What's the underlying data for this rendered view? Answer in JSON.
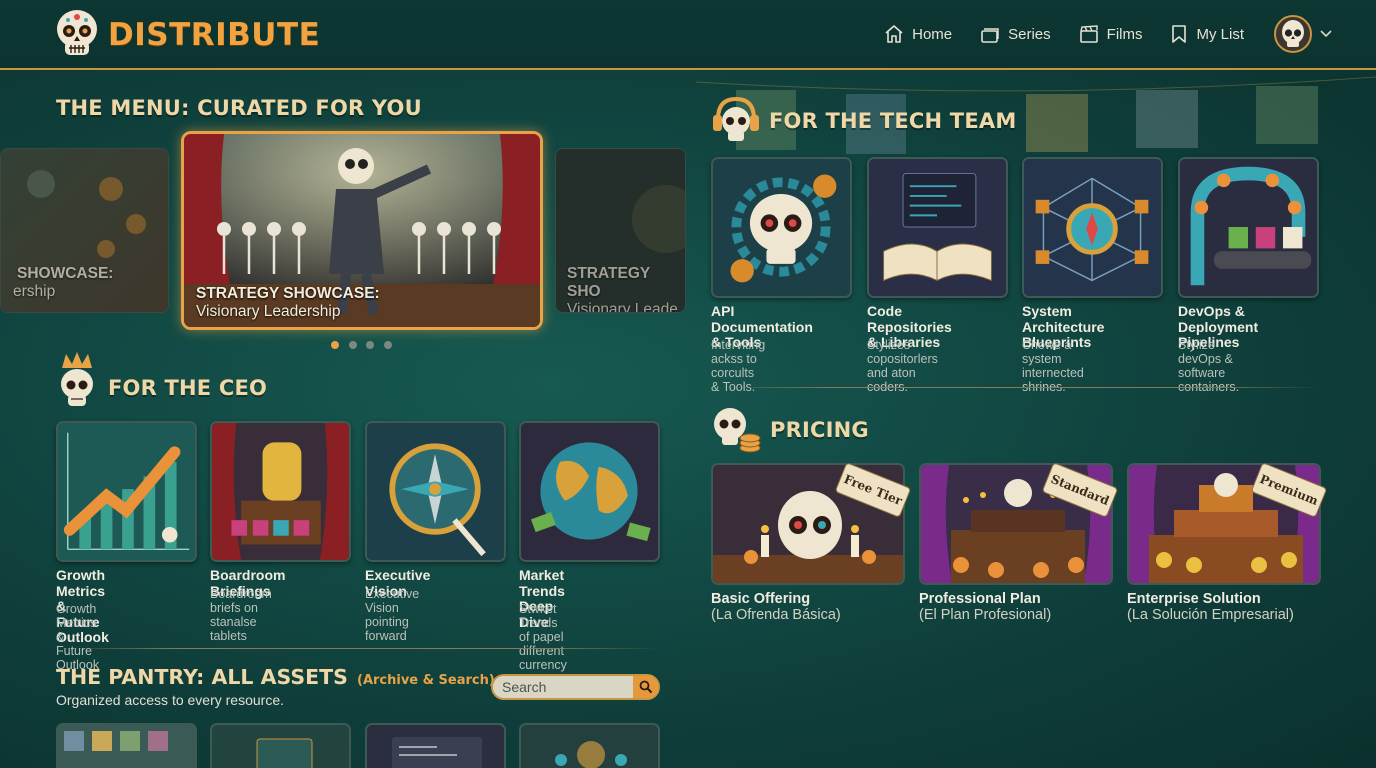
{
  "brand": {
    "name": "DISTRIBUTE",
    "logo_icon": "sugar-skull-icon"
  },
  "nav": {
    "items": [
      {
        "label": "Home",
        "icon": "house-icon"
      },
      {
        "label": "Series",
        "icon": "stack-icon"
      },
      {
        "label": "Films",
        "icon": "clapperboard-icon"
      },
      {
        "label": "My List",
        "icon": "bookmark-icon"
      }
    ],
    "avatar_icon": "skull-avatar-icon",
    "caret_icon": "chevron-down-icon"
  },
  "menu": {
    "title": "THE MENU: CURATED FOR YOU",
    "slides": [
      {
        "line1": "SHOWCASE:",
        "line2": "ership"
      },
      {
        "line1": "STRATEGY SHOWCASE:",
        "line2": "Visionary Leadership"
      },
      {
        "line1": "STRATEGY SHO",
        "line2": "Visionary Leade"
      }
    ],
    "active_slide": 1,
    "dot_count": 4
  },
  "ceo": {
    "title": "FOR THE CEO",
    "cards": [
      {
        "title": "Growth Metrics\n& Future Outlook",
        "desc": "Growth Metrics &\nFuture Outlook"
      },
      {
        "title": "Boardroom Briefings",
        "desc": "Boardroom briefs on\nstanalse tablets"
      },
      {
        "title": "Executive Vision",
        "desc": "Executive Vision\npointing forward"
      },
      {
        "title": "Market Trends\nDeep Dive",
        "desc": "Stwket Trends of papel\ndifferent currency"
      }
    ]
  },
  "tech": {
    "title": "FOR THE TECH TEAM",
    "cards": [
      {
        "title": "API Documentation\n& Tools",
        "desc": "Interviting ackss to\ncorcults & Tools."
      },
      {
        "title": "Code Repositories\n& Libraries",
        "desc": "Stylizes copositorlers\nand aton coders."
      },
      {
        "title": "System Architecture\nBlueprints",
        "desc": "Chowe a system\ninternected shrines."
      },
      {
        "title": "DevOps &\nDeployment Pipelines",
        "desc": "Stylize devOps &\nsoftware containers."
      }
    ]
  },
  "pricing": {
    "title": "PRICING",
    "plans": [
      {
        "tag": "Free Tier",
        "name": "Basic Offering",
        "sub": "(La Ofrenda Básica)"
      },
      {
        "tag": "Standard",
        "name": "Professional Plan",
        "sub": "(El Plan Profesional)"
      },
      {
        "tag": "Premium",
        "name": "Enterprise Solution",
        "sub": "(La Solución Empresarial)"
      }
    ]
  },
  "pantry": {
    "title": "THE PANTRY: ALL ASSETS",
    "subtitle": "(Archive & Search)",
    "description": "Organized access to every resource.",
    "search_placeholder": "Search",
    "search_icon": "magnifier-icon"
  },
  "colors": {
    "background": "#124a45",
    "accent": "#e9a347",
    "header": "#0d3733",
    "title": "#efd7a6"
  }
}
